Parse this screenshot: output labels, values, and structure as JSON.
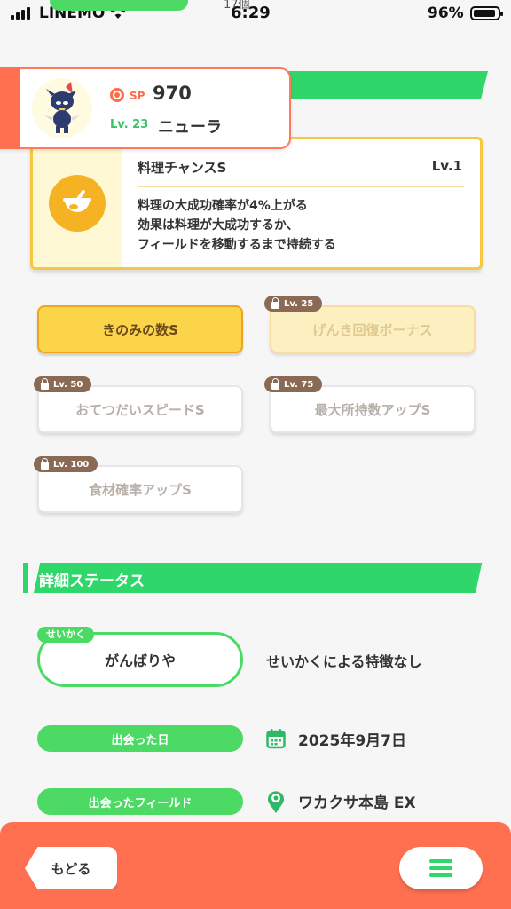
{
  "status_bar": {
    "carrier": "LINEMO",
    "time": "6:29",
    "battery": "96%",
    "peek_text": "17個"
  },
  "pokemon": {
    "sp_label": "SP",
    "sp_value": "970",
    "level": "Lv. 23",
    "name": "ニューラ"
  },
  "main_skill": {
    "name": "料理チャンスS",
    "level": "Lv.1",
    "description": "料理の大成功確率が4%上がる\n効果は料理が大成功するか、\nフィールドを移動するまで持続する"
  },
  "sub_skills": [
    {
      "label": "きのみの数S",
      "lock": ""
    },
    {
      "label": "げんき回復ボーナス",
      "lock": "Lv. 25"
    },
    {
      "label": "おてつだいスピードS",
      "lock": "Lv. 50"
    },
    {
      "label": "最大所持数アップS",
      "lock": "Lv. 75"
    },
    {
      "label": "食材確率アップS",
      "lock": "Lv. 100"
    }
  ],
  "details": {
    "section_title": "詳細ステータス",
    "nature_tag": "せいかく",
    "nature": "がんばりや",
    "nature_effect": "せいかくによる特徴なし",
    "met_date_label": "出会った日",
    "met_date": "2025年9月7日",
    "met_field_label": "出会ったフィールド",
    "met_field": "ワカクサ本島 EX"
  },
  "footer": {
    "back_label": "もどる"
  },
  "colors": {
    "accent_green": "#2fd66a",
    "accent_orange": "#ff7050",
    "skill_gold": "#f6c842"
  }
}
